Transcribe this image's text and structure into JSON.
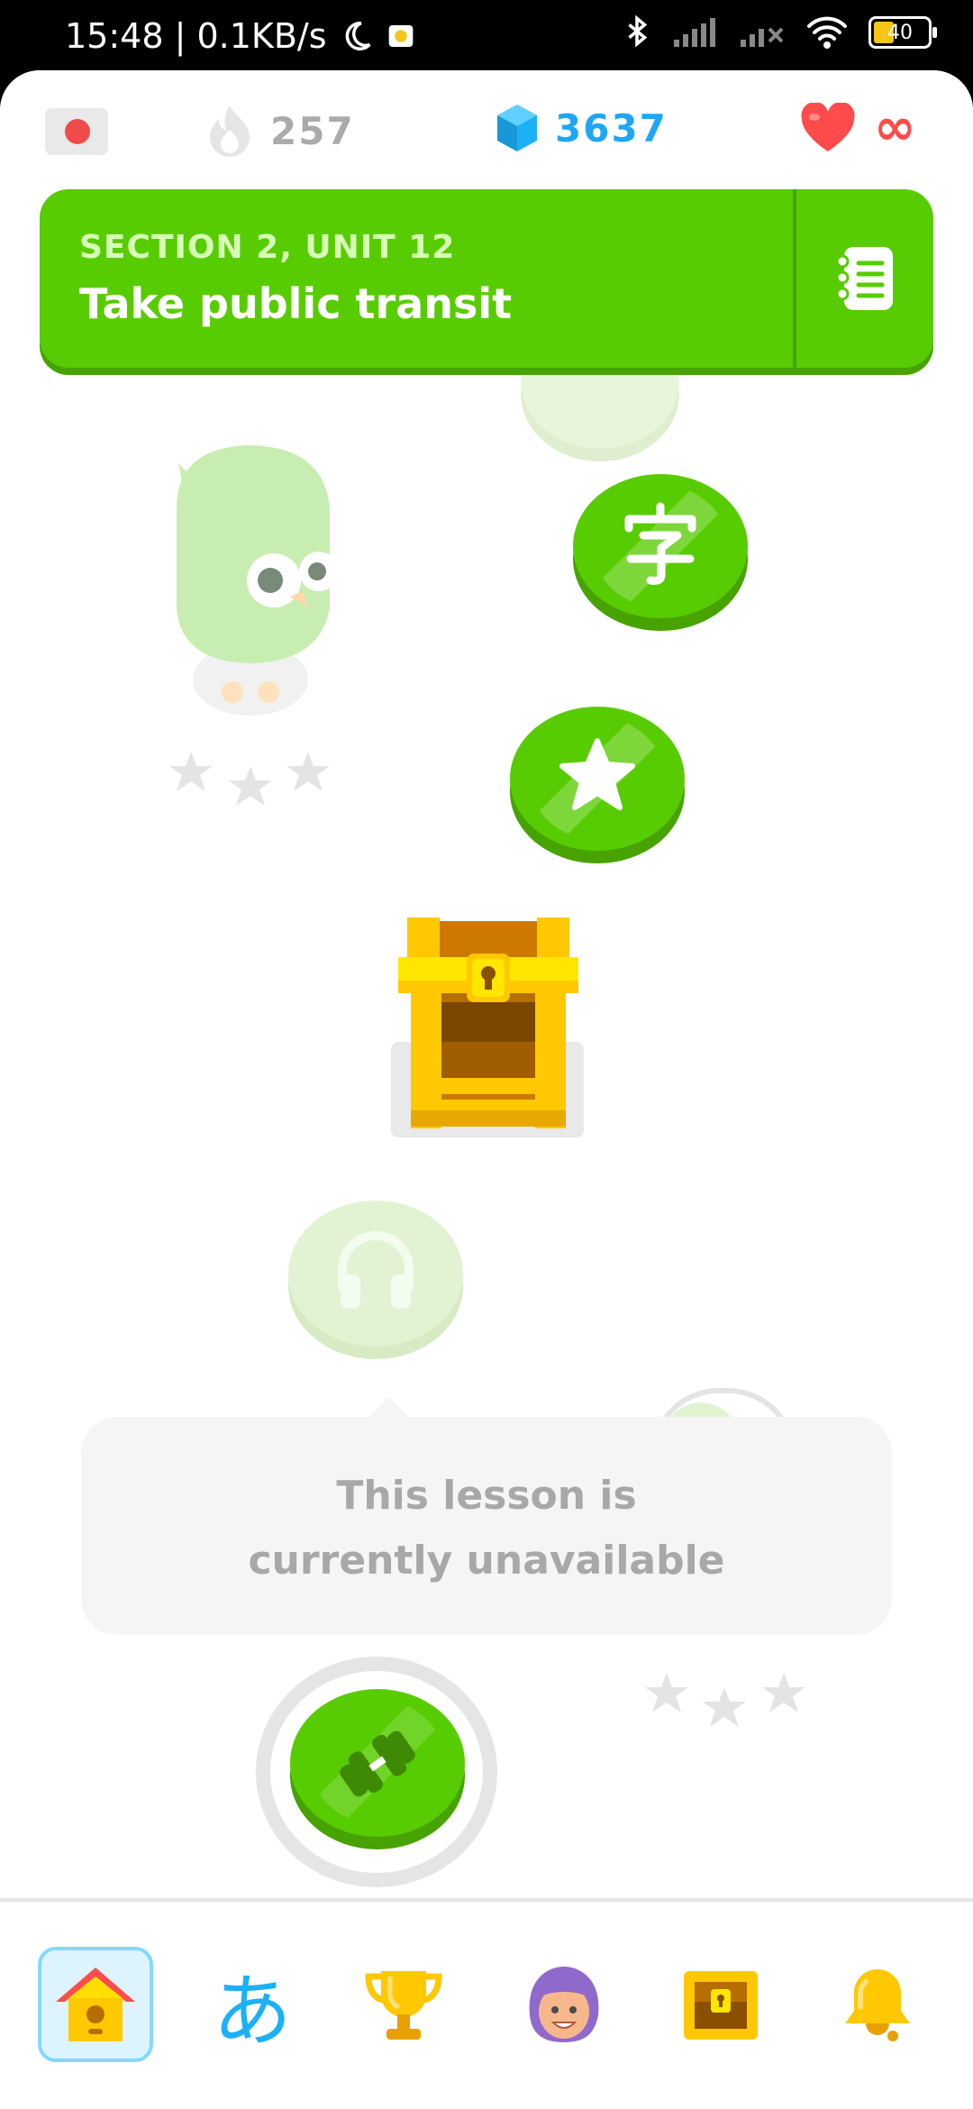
{
  "status_bar": {
    "time_speed": "15:48 | 0.1KB/s",
    "battery": "40"
  },
  "top_bar": {
    "streak_count": "257",
    "gems_count": "3637",
    "hearts": "∞"
  },
  "unit": {
    "section_label": "SECTION 2, UNIT 12",
    "title": "Take public transit"
  },
  "tooltip": {
    "message": "This lesson is currently unavailable"
  },
  "nav": {
    "hiragana_glyph": "あ"
  },
  "colors": {
    "green": "#58cc02",
    "blue": "#1cb0f6",
    "red": "#ff4b4b",
    "gold": "#ffc800"
  }
}
